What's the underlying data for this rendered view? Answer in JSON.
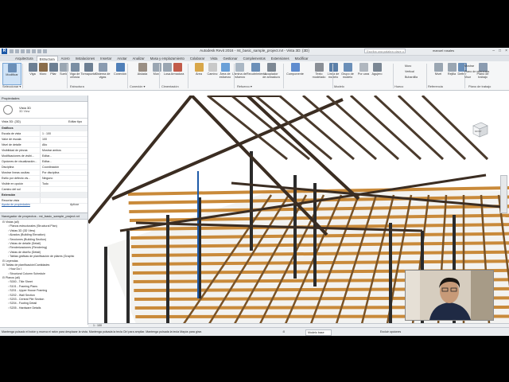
{
  "window": {
    "title": "Autodesk Revit 2016 -   rst_basic_sample_project.rvt - Vista 3D: {3D}",
    "search_placeholder": "Escriba una palabra clave o una frase",
    "user": "manuel rosales"
  },
  "tabs": [
    "Arquitectura",
    "Estructura",
    "Acero",
    "Instalaciones",
    "Insertar",
    "Anotar",
    "Analizar",
    "Masa y emplazamiento",
    "Colaborar",
    "Vista",
    "Gestionar",
    "Complementos",
    "Extensiones",
    "Modificar"
  ],
  "active_tab": "Estructura",
  "ribbon": {
    "modify": "Modificar",
    "buttons": [
      "Viga",
      "Muro",
      "Pilar",
      "Suelo",
      "Viga de celosía",
      "Tornapunta",
      "Sistema de vigas",
      "Conexión",
      "Aislada",
      "Muro",
      "Losa",
      "Armadura",
      "Área",
      "Camino",
      "Área de esfuerzo",
      "Lámina de esfuerzo",
      "Recubrimiento",
      "Acoplador de armadura",
      "Componente",
      "Texto modelado",
      "Línea de modelo",
      "Grupo de modelo",
      "Por cara",
      "Agujero",
      "Nivel",
      "Rejilla",
      "Definir",
      "Plano de trabajo"
    ],
    "hueco_small": [
      "Muro",
      "Vertical",
      "Buhardilla"
    ],
    "ref_small": [
      "Mostrar",
      "Plano de referencia",
      "Visor"
    ],
    "groups": [
      "Seleccionar ▾",
      "Estructura",
      "Conexión ▾",
      "Cimentación",
      "Refuerzo ▾",
      "Modelo",
      "Hueco",
      "Referencia",
      "Plano de trabajo"
    ]
  },
  "properties": {
    "header": "Propiedades",
    "type_name": "Vista 3D",
    "type_sub": "3D View",
    "filter": "Vista 3D: {3D}",
    "edit_type": "Editar tipo",
    "rows": [
      {
        "k": "Gráficos",
        "v": "",
        "cat": true
      },
      {
        "k": "Escala de vista",
        "v": "1 : 100"
      },
      {
        "k": "Valor de escala",
        "v": "100"
      },
      {
        "k": "Nivel de detalle",
        "v": "Alto"
      },
      {
        "k": "Visibilidad de piezas",
        "v": "Mostrar ambos"
      },
      {
        "k": "Modificaciones de visibi...",
        "v": "Editar..."
      },
      {
        "k": "Opciones de visualización...",
        "v": "Editar..."
      },
      {
        "k": "Disciplina",
        "v": "Coordinación"
      },
      {
        "k": "Mostrar líneas ocultas",
        "v": "Por disciplina"
      },
      {
        "k": "Estilo por defecto vis...",
        "v": "Ninguno"
      },
      {
        "k": "Visible en opción",
        "v": "Todo"
      },
      {
        "k": "Camino del sol",
        "v": ""
      },
      {
        "k": "Extensión",
        "v": "",
        "cat": true
      },
      {
        "k": "Recortar vista",
        "v": ""
      }
    ],
    "help": "Ayuda de propiedades",
    "apply": "Aplicar"
  },
  "browser": {
    "header": "Navegador de proyectos - rst_basic_sample_project.rvt",
    "items": [
      {
        "d": 0,
        "t": "Vistas (all)"
      },
      {
        "d": 1,
        "t": "Planos estructurales (Structural Plan)"
      },
      {
        "d": 1,
        "t": "Vistas 3D (3D View)"
      },
      {
        "d": 1,
        "t": "Alzados (Building Elevation)"
      },
      {
        "d": 1,
        "t": "Secciones (Building Section)"
      },
      {
        "d": 1,
        "t": "Vistas de detalle (Detail)"
      },
      {
        "d": 1,
        "t": "Renderizaciones (Rendering)"
      },
      {
        "d": 1,
        "t": "Vistas de diseño (Detail)"
      },
      {
        "d": 1,
        "t": "Tablas gráficas de planificación de pilares (Graphic"
      },
      {
        "d": 0,
        "t": "Leyendas"
      },
      {
        "d": 0,
        "t": "Tablas de planificación/Cantidades"
      },
      {
        "d": 1,
        "t": "How Do I"
      },
      {
        "d": 1,
        "t": "Structural Column Schedule"
      },
      {
        "d": 0,
        "t": "Planos (all)"
      },
      {
        "d": 1,
        "t": "S000 - Title Sheet"
      },
      {
        "d": 1,
        "t": "S101 - Framing Plans"
      },
      {
        "d": 1,
        "t": "S201 - Upper House Framing"
      },
      {
        "d": 1,
        "t": "S202 - Wall Section"
      },
      {
        "d": 1,
        "t": "S203 - Central Pile Section"
      },
      {
        "d": 1,
        "t": "S204 - Footing Detail"
      },
      {
        "d": 1,
        "t": "S205 - Hardware Details"
      }
    ]
  },
  "viewcube": {
    "label": "FRONT"
  },
  "viewbar": {
    "scale": "1 : 100"
  },
  "status": {
    "hint": "Mantenga pulsado el botón y mueva el ratón para desplazar la vista. Mantenga pulsada la tecla Ctrl para ampliar. Mantenga pulsada la tecla Mayús para girar.",
    "zero": ":0",
    "model": "Modelo base",
    "excl": "Excluir opciones"
  },
  "colors": {
    "joist": "#c98a3a",
    "beam": "#3b2d22",
    "column": "#2b2b2b",
    "accent": "#1e5aa8"
  }
}
